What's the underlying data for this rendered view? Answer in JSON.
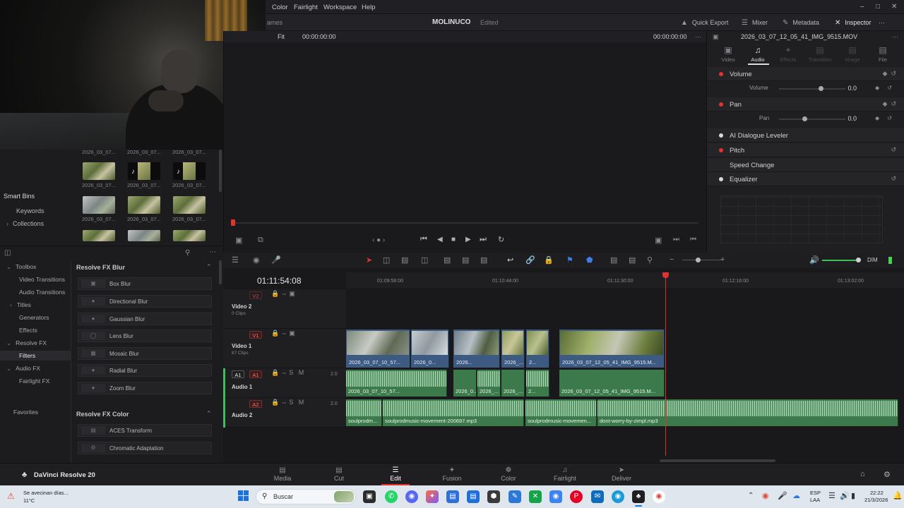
{
  "menubar": {
    "items": [
      "Color",
      "Fairlight",
      "Workspace",
      "Help"
    ],
    "window_controls": [
      "–",
      "□",
      "✕"
    ]
  },
  "header": {
    "project_title": "MOLINUCO",
    "project_status": "Edited",
    "partial_label": "ames",
    "buttons": [
      "Quick Export",
      "Mixer",
      "Metadata",
      "Inspector"
    ]
  },
  "viewer": {
    "zoom": "Fit",
    "timecode_left": "00:00:00:00",
    "timecode_right": "00:00:00:00",
    "clip_name": "2026_03_07_12_05_41_IMG_9515.MOV"
  },
  "media_pool": {
    "thumb_label": "2026_03_07...",
    "bins": [
      "Smart Bins",
      "Keywords",
      "Collections"
    ]
  },
  "inspector": {
    "tabs": [
      "Video",
      "Audio",
      "Effects",
      "Transition",
      "Image",
      "File"
    ],
    "active_tab": "Audio",
    "sections": {
      "volume": "Volume",
      "volume_param": "Volume",
      "volume_value": "0.0",
      "pan": "Pan",
      "pan_param": "Pan",
      "pan_value": "0.0",
      "dialogue": "AI Dialogue Leveler",
      "pitch": "Pitch",
      "speed": "Speed Change",
      "equalizer": "Equalizer"
    }
  },
  "effects": {
    "tree": [
      "Toolbox",
      "Video Transitions",
      "Audio Transitions",
      "Titles",
      "Generators",
      "Effects",
      "Resolve FX",
      "Filters",
      "Audio FX",
      "Fairlight FX",
      "Favorites"
    ],
    "selected": "Filters",
    "group_blur": "Resolve FX Blur",
    "blur_items": [
      "Box Blur",
      "Directional Blur",
      "Gaussian Blur",
      "Lens Blur",
      "Mosaic Blur",
      "Radial Blur",
      "Zoom Blur"
    ],
    "group_color": "Resolve FX Color",
    "color_items": [
      "ACES Transform",
      "Chromatic Adaptation"
    ]
  },
  "timeline": {
    "timecode": "01:11:54:08",
    "ruler": [
      "01:09:58:00",
      "01:10:44:00",
      "01:11:30:00",
      "01:12:16:00",
      "01:13:02:00"
    ],
    "tracks": {
      "v2": {
        "id": "V2",
        "name": "Video 2",
        "sub": "0 Clips"
      },
      "v1": {
        "id": "V1",
        "name": "Video 1",
        "sub": "87 Clips"
      },
      "a1": {
        "id": "A1",
        "name": "Audio 1",
        "ch": "2.0"
      },
      "a2": {
        "id": "A2",
        "name": "Audio 2",
        "ch": "2.0"
      }
    },
    "video_clips": [
      "2026_03_07_10_57...",
      "2026_0...",
      "2026...",
      "2026_...",
      "2...",
      "2026_03_07_12_05_41_IMG_9515.M..."
    ],
    "audio1_clips": [
      "2026_03_07_10_57...",
      "2026_0...",
      "2026_...",
      "2026_...",
      "2...",
      "2026_03_07_12_05_41_IMG_9515.M..."
    ],
    "audio2_clips": [
      "soulprodm...",
      "soulprodmusic-movement-200697.mp3",
      "soulprodmusic-movemen...",
      "dont-worry-by-zimpl.mp3"
    ],
    "dim_label": "DIM"
  },
  "pagebar": {
    "app_name": "DaVinci Resolve 20",
    "pages": [
      "Media",
      "Cut",
      "Edit",
      "Fusion",
      "Color",
      "Fairlight",
      "Deliver"
    ],
    "active_page": "Edit"
  },
  "taskbar": {
    "weather_text": "Se avecinan días...",
    "weather_temp": "11°C",
    "search_placeholder": "Buscar",
    "lang_top": "ESP",
    "lang_bottom": "LAA",
    "time": "22:22",
    "date": "21/3/2026"
  }
}
